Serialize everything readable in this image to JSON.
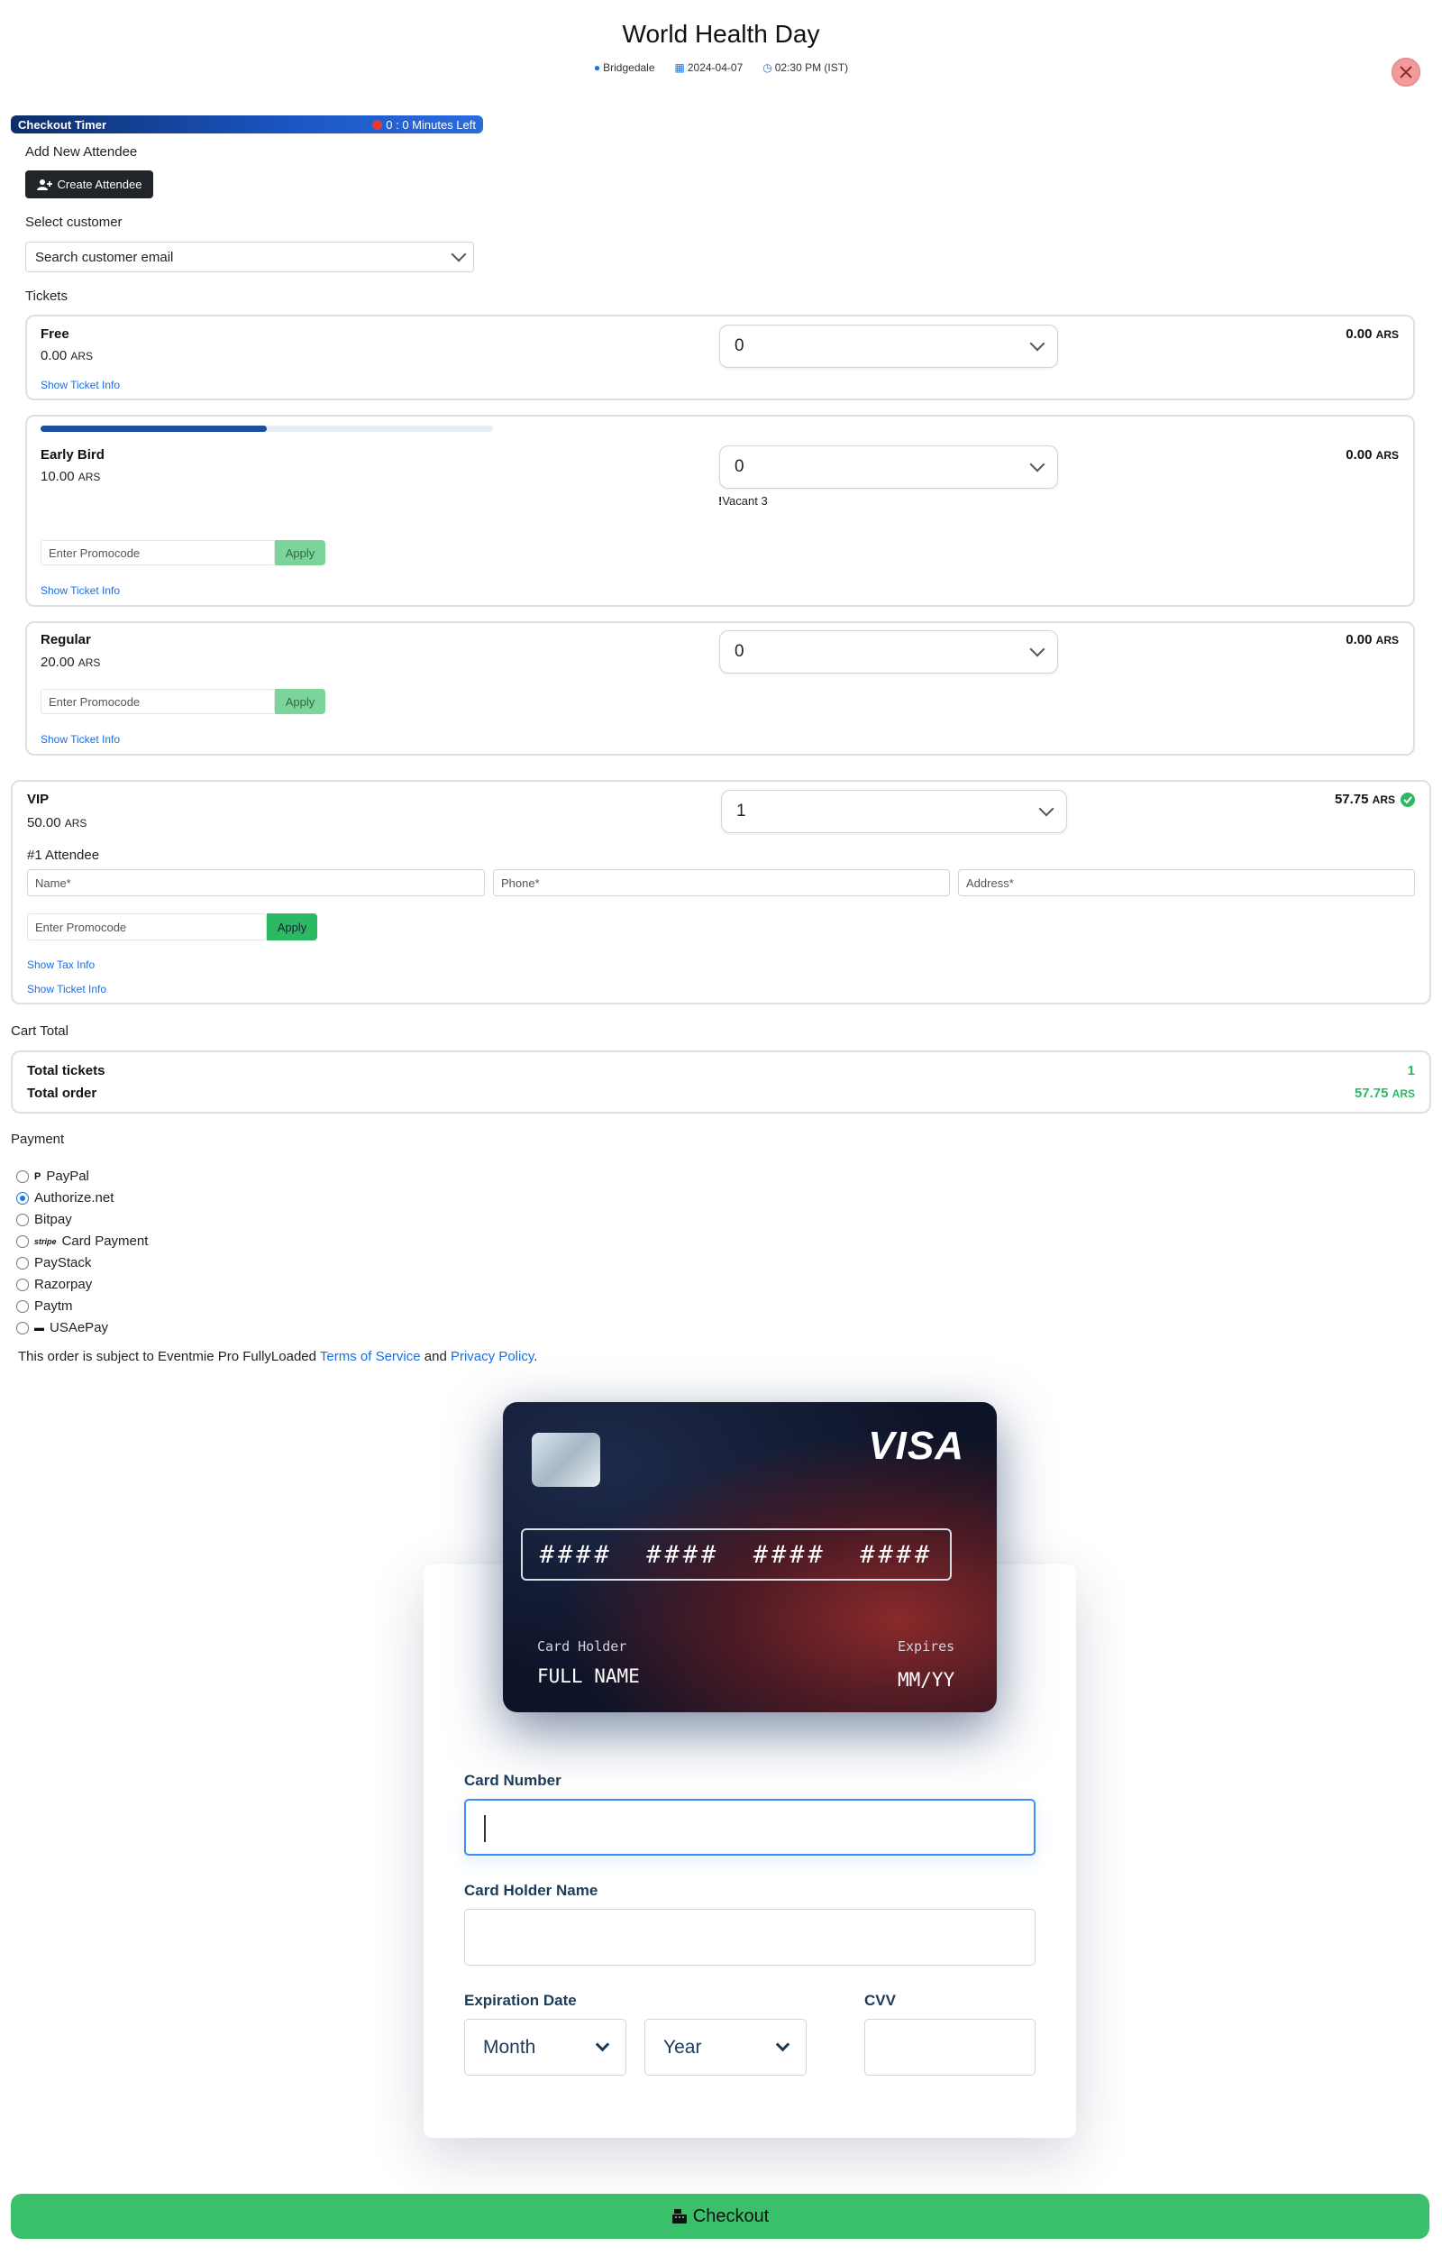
{
  "event": {
    "title": "World Health Day",
    "location": "Bridgedale",
    "date": "2024-04-07",
    "time": "02:30 PM (IST)"
  },
  "timer": {
    "label": "Checkout Timer",
    "remaining": "0 : 0 Minutes Left"
  },
  "attendee": {
    "section_label": "Add New Attendee",
    "create_button": "Create Attendee"
  },
  "customer": {
    "section_label": "Select customer",
    "placeholder": "Search customer email"
  },
  "tickets": {
    "section_label": "Tickets",
    "items": [
      {
        "name": "Free",
        "price": "0.00",
        "currency": "ARS",
        "qty": "0",
        "amount": "0.00",
        "info_link": "Show Ticket Info"
      },
      {
        "name": "Early Bird",
        "price": "10.00",
        "currency": "ARS",
        "qty": "0",
        "amount": "0.00",
        "vacant": "Vacant 3",
        "vacant_mark": "!",
        "availability_fraction": 0.5,
        "promo_placeholder": "Enter Promocode",
        "apply_label": "Apply",
        "info_link": "Show Ticket Info"
      },
      {
        "name": "Regular",
        "price": "20.00",
        "currency": "ARS",
        "qty": "0",
        "amount": "0.00",
        "promo_placeholder": "Enter Promocode",
        "apply_label": "Apply",
        "info_link": "Show Ticket Info"
      },
      {
        "name": "VIP",
        "price": "50.00",
        "currency": "ARS",
        "qty": "1",
        "amount": "57.75",
        "attendee_heading": "#1 Attendee",
        "name_placeholder": "Name*",
        "phone_placeholder": "Phone*",
        "address_placeholder": "Address*",
        "promo_placeholder": "Enter Promocode",
        "apply_label": "Apply",
        "tax_link": "Show Tax Info",
        "info_link": "Show Ticket Info"
      }
    ]
  },
  "cart": {
    "section_label": "Cart Total",
    "total_tickets_label": "Total tickets",
    "total_tickets_value": "1",
    "total_order_label": "Total order",
    "total_order_value": "57.75",
    "currency": "ARS"
  },
  "payment": {
    "section_label": "Payment",
    "selected": "Authorize.net",
    "methods": [
      "PayPal",
      "Authorize.net",
      "Bitpay",
      "Card Payment",
      "PayStack",
      "Razorpay",
      "Paytm",
      "USAePay"
    ],
    "stripe_badge": "stripe",
    "terms_prefix": "This order is subject to Eventmie Pro FullyLoaded ",
    "terms_link": "Terms of Service",
    "terms_and": " and ",
    "privacy_link": "Privacy Policy",
    "terms_suffix": "."
  },
  "card_preview": {
    "brand": "VISA",
    "number_groups": [
      "####",
      "####",
      "####",
      "####"
    ],
    "holder_label": "Card Holder",
    "holder_value": "FULL NAME",
    "expires_label": "Expires",
    "expires_value": "MM/YY"
  },
  "card_form": {
    "number_label": "Card Number",
    "holder_label": "Card Holder Name",
    "expiration_label": "Expiration Date",
    "month_placeholder": "Month",
    "year_placeholder": "Year",
    "cvv_label": "CVV"
  },
  "checkout_label": "Checkout",
  "colors": {
    "primary_link": "#1a6fe6",
    "success": "#3ac06b",
    "danger": "#e53935",
    "timer_bar": "#1b56c4"
  }
}
